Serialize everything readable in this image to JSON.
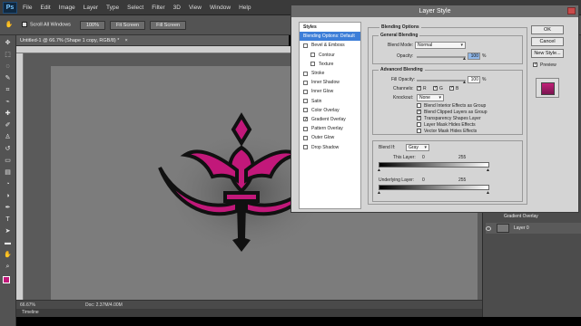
{
  "app": {
    "logo": "Ps",
    "menus": [
      "File",
      "Edit",
      "Image",
      "Layer",
      "Type",
      "Select",
      "Filter",
      "3D",
      "View",
      "Window",
      "Help"
    ]
  },
  "options_bar": {
    "scroll_all_windows": "Scroll All Windows",
    "zoom_100": "100%",
    "fit_screen": "Fit Screen",
    "fill_screen": "Fill Screen"
  },
  "document": {
    "tab_title": "Untitled-1 @ 66.7% (Shape 1 copy, RGB/8) *",
    "zoom": "66.67%",
    "doc_size": "Doc: 2.37M/4.00M",
    "timeline": "Timeline"
  },
  "dialog": {
    "title": "Layer Style",
    "styles_header": "Styles",
    "styles": [
      {
        "label": "Blending Options: Default",
        "checkbox": false,
        "checked": false,
        "selected": true,
        "indent": false
      },
      {
        "label": "Bevel & Emboss",
        "checkbox": true,
        "checked": false,
        "selected": false,
        "indent": false
      },
      {
        "label": "Contour",
        "checkbox": true,
        "checked": false,
        "selected": false,
        "indent": true
      },
      {
        "label": "Texture",
        "checkbox": true,
        "checked": false,
        "selected": false,
        "indent": true
      },
      {
        "label": "Stroke",
        "checkbox": true,
        "checked": false,
        "selected": false,
        "indent": false
      },
      {
        "label": "Inner Shadow",
        "checkbox": true,
        "checked": false,
        "selected": false,
        "indent": false
      },
      {
        "label": "Inner Glow",
        "checkbox": true,
        "checked": false,
        "selected": false,
        "indent": false
      },
      {
        "label": "Satin",
        "checkbox": true,
        "checked": false,
        "selected": false,
        "indent": false
      },
      {
        "label": "Color Overlay",
        "checkbox": true,
        "checked": false,
        "selected": false,
        "indent": false
      },
      {
        "label": "Gradient Overlay",
        "checkbox": true,
        "checked": true,
        "selected": false,
        "indent": false
      },
      {
        "label": "Pattern Overlay",
        "checkbox": true,
        "checked": false,
        "selected": false,
        "indent": false
      },
      {
        "label": "Outer Glow",
        "checkbox": true,
        "checked": false,
        "selected": false,
        "indent": false
      },
      {
        "label": "Drop Shadow",
        "checkbox": true,
        "checked": false,
        "selected": false,
        "indent": false
      }
    ],
    "blending_options": {
      "section_title": "Blending Options",
      "general_title": "General Blending",
      "blend_mode_label": "Blend Mode:",
      "blend_mode_value": "Normal",
      "opacity_label": "Opacity:",
      "opacity_value": "100",
      "percent": "%"
    },
    "advanced": {
      "title": "Advanced Blending",
      "fill_opacity_label": "Fill Opacity:",
      "fill_opacity_value": "100",
      "channels_label": "Channels:",
      "channels": [
        "R",
        "G",
        "B"
      ],
      "knockout_label": "Knockout:",
      "knockout_value": "None",
      "options": [
        {
          "label": "Blend Interior Effects as Group",
          "checked": false
        },
        {
          "label": "Blend Clipped Layers as Group",
          "checked": true
        },
        {
          "label": "Transparency Shapes Layer",
          "checked": true
        },
        {
          "label": "Layer Mask Hides Effects",
          "checked": false
        },
        {
          "label": "Vector Mask Hides Effects",
          "checked": false
        }
      ]
    },
    "blend_if": {
      "label": "Blend If:",
      "value": "Gray",
      "this_layer_label": "This Layer:",
      "this_min": "0",
      "this_max": "255",
      "underlying_label": "Underlying Layer:",
      "under_min": "0",
      "under_max": "255"
    },
    "buttons": {
      "ok": "OK",
      "cancel": "Cancel",
      "new_style": "New Style...",
      "preview": "Preview"
    },
    "preview_checked": true
  },
  "layers": {
    "effect_row": "Gradient Overlay",
    "layer0": "Layer 0"
  },
  "colors": {
    "accent_magenta": "#c2187a",
    "selection_blue": "#3d7ed8"
  }
}
